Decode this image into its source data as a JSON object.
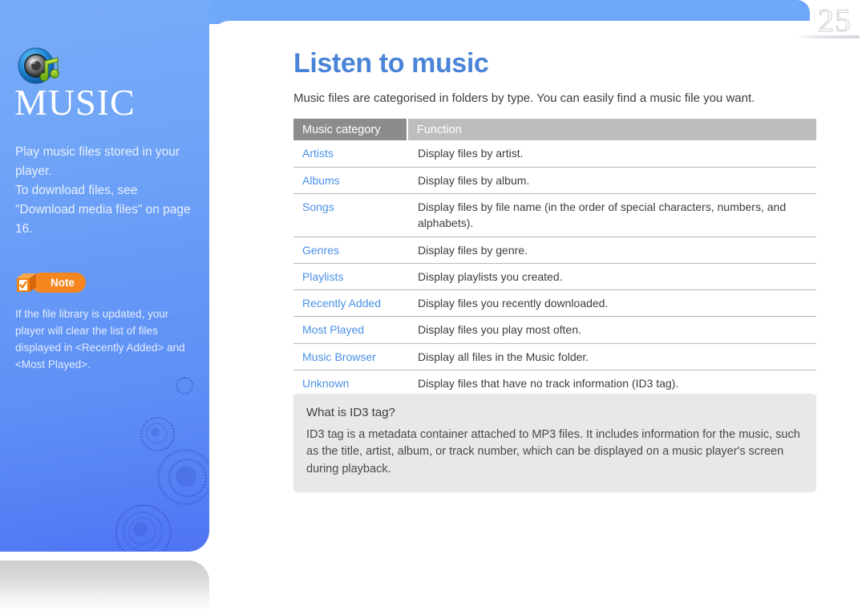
{
  "page": {
    "number": "25",
    "accent_blue": "#4a84d8",
    "sidebar_blue": "#6fa4f7",
    "note_orange": "#f6861f",
    "link_blue": "#4a90e8"
  },
  "sidebar": {
    "icon_name": "music-speaker-icon",
    "title": "MUSIC",
    "description": "Play music files stored in your player.\nTo download files, see \"Download media files\" on page 16.",
    "note": {
      "badge_icon_name": "note-box-check-icon",
      "badge_label": "Note",
      "text": "If the file library is updated, your player will clear the list of files displayed in <Recently Added> and <Most Played>."
    }
  },
  "main": {
    "title": "Listen to music",
    "intro": "Music files are categorised in folders by type. You can easily find a music file you want.",
    "table": {
      "headers": [
        "Music category",
        "Function"
      ],
      "rows": [
        {
          "category": "Artists",
          "function": "Display files by artist."
        },
        {
          "category": "Albums",
          "function": "Display files by album."
        },
        {
          "category": "Songs",
          "function": "Display files by file name (in the order of special characters, numbers, and alphabets)."
        },
        {
          "category": "Genres",
          "function": "Display files by genre."
        },
        {
          "category": "Playlists",
          "function": "Display playlists you created."
        },
        {
          "category": "Recently Added",
          "function": "Display files you recently downloaded."
        },
        {
          "category": "Most Played",
          "function": "Display files you play most often."
        },
        {
          "category": "Music Browser",
          "function": "Display all files in the Music folder."
        },
        {
          "category": "Unknown",
          "function": "Display files that have no track information (ID3 tag)."
        }
      ]
    },
    "infobox": {
      "title": "What is ID3 tag?",
      "body": "ID3 tag is a metadata container attached to MP3 files. It includes information for the music, such as the title, artist, album, or track number, which can be displayed on a music player's screen during playback."
    }
  }
}
